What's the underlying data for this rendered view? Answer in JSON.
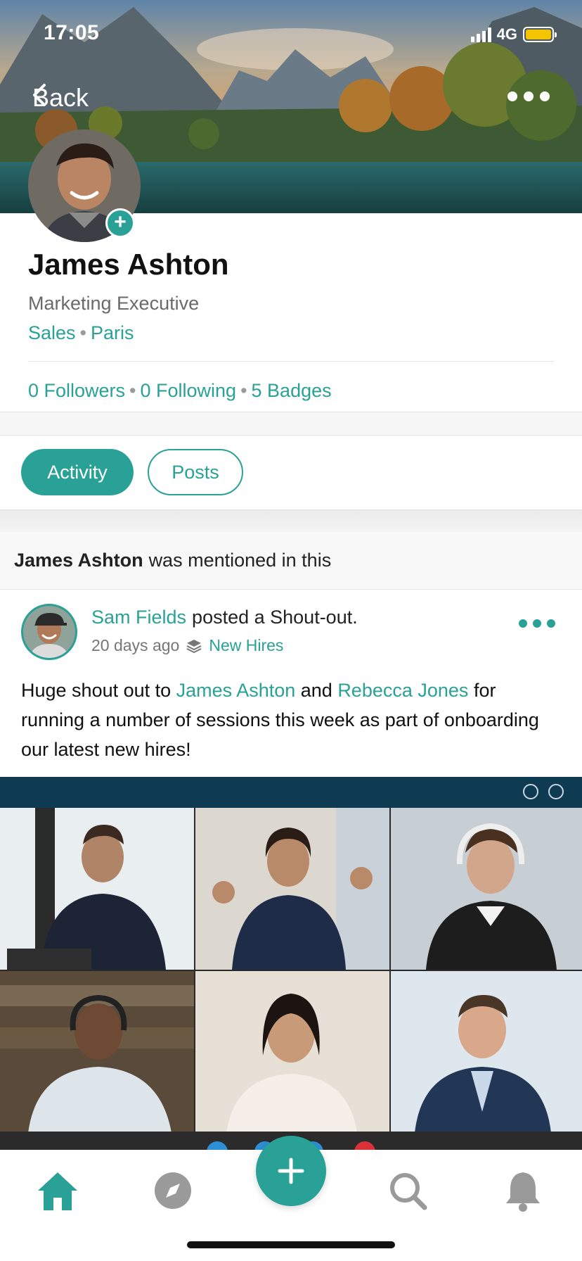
{
  "status_bar": {
    "time": "17:05",
    "network": "4G"
  },
  "header": {
    "back_label": "Back"
  },
  "profile": {
    "name": "James Ashton",
    "title": "Marketing Executive",
    "department": "Sales",
    "location": "Paris",
    "stats": {
      "followers": "0 Followers",
      "following": "0 Following",
      "badges": "5 Badges"
    }
  },
  "tabs": [
    {
      "label": "Activity",
      "active": true
    },
    {
      "label": "Posts",
      "active": false
    }
  ],
  "mention": {
    "name": "James Ashton",
    "text": "was mentioned in this"
  },
  "post": {
    "author": "Sam Fields",
    "action": "posted a Shout-out.",
    "time": "20 days ago",
    "group": "New Hires",
    "body": {
      "part1": "Huge shout out to ",
      "mention1": "James Ashton",
      "part2": " and ",
      "mention2": "Rebecca Jones",
      "part3": " for running a number of sessions this week as part of onboarding our latest new hires!"
    }
  },
  "nav": {
    "items": [
      "home-icon",
      "compass-icon",
      "plus-icon",
      "search-icon",
      "bell-icon"
    ],
    "active": "home-icon"
  },
  "colors": {
    "accent": "#2aa197",
    "battery": "#f5c400",
    "call_bar": "#0e3a52"
  }
}
